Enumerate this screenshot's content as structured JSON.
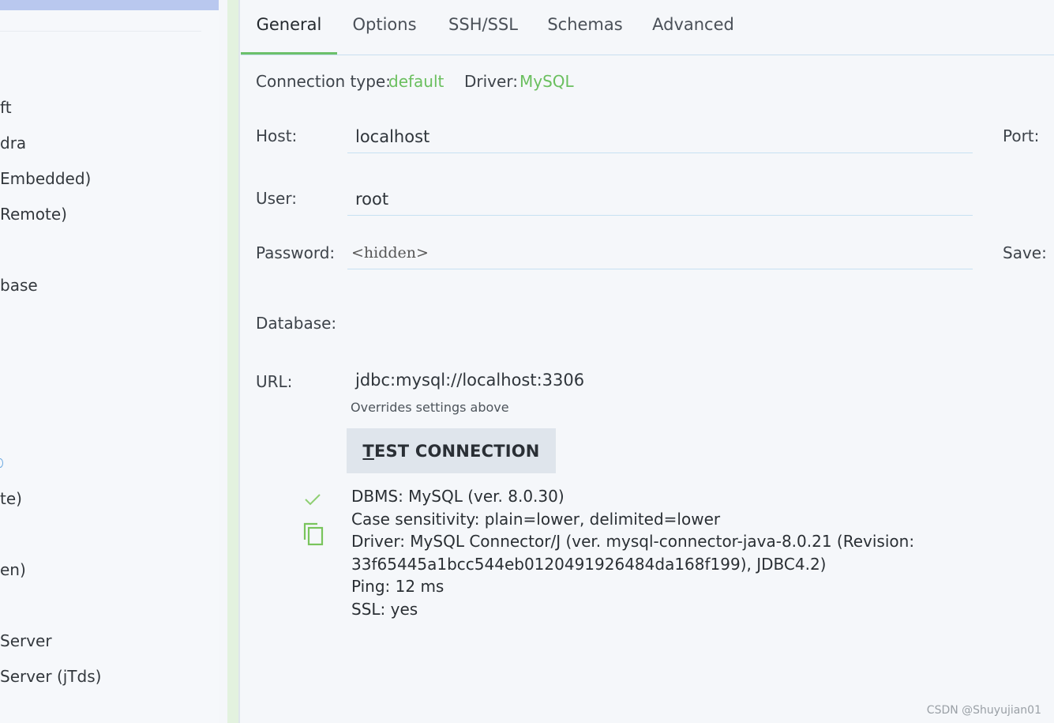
{
  "sidebar": {
    "items": [
      "ft",
      "dra",
      "Embedded)",
      "Remote)",
      "base",
      "te)",
      "en)",
      "Server",
      "Server (jTds)"
    ]
  },
  "tabs": [
    "General",
    "Options",
    "SSH/SSL",
    "Schemas",
    "Advanced"
  ],
  "active_tab": "General",
  "connection": {
    "type_label": "Connection type:",
    "type_value": "default",
    "driver_label": "Driver:",
    "driver_value": "MySQL"
  },
  "form": {
    "host_label": "Host:",
    "host_value": "localhost",
    "port_label": "Port:",
    "user_label": "User:",
    "user_value": "root",
    "password_label": "Password:",
    "password_value": "<hidden>",
    "save_label": "Save:",
    "database_label": "Database:",
    "url_label": "URL:",
    "url_value": "jdbc:mysql://localhost:3306",
    "url_hint": "Overrides settings above"
  },
  "test_button": {
    "first_letter": "T",
    "rest": "EST CONNECTION"
  },
  "result": {
    "lines": [
      "DBMS: MySQL (ver. 8.0.30)",
      "Case sensitivity: plain=lower, delimited=lower",
      "Driver: MySQL Connector/J (ver. mysql-connector-java-8.0.21 (Revision:",
      "33f65445a1bcc544eb0120491926484da168f199), JDBC4.2)",
      "Ping: 12 ms",
      "SSL: yes"
    ]
  },
  "colors": {
    "accent_green": "#6abf5e",
    "selected_blue": "#b9c8ef"
  },
  "watermark": "CSDN @Shuyujian01"
}
